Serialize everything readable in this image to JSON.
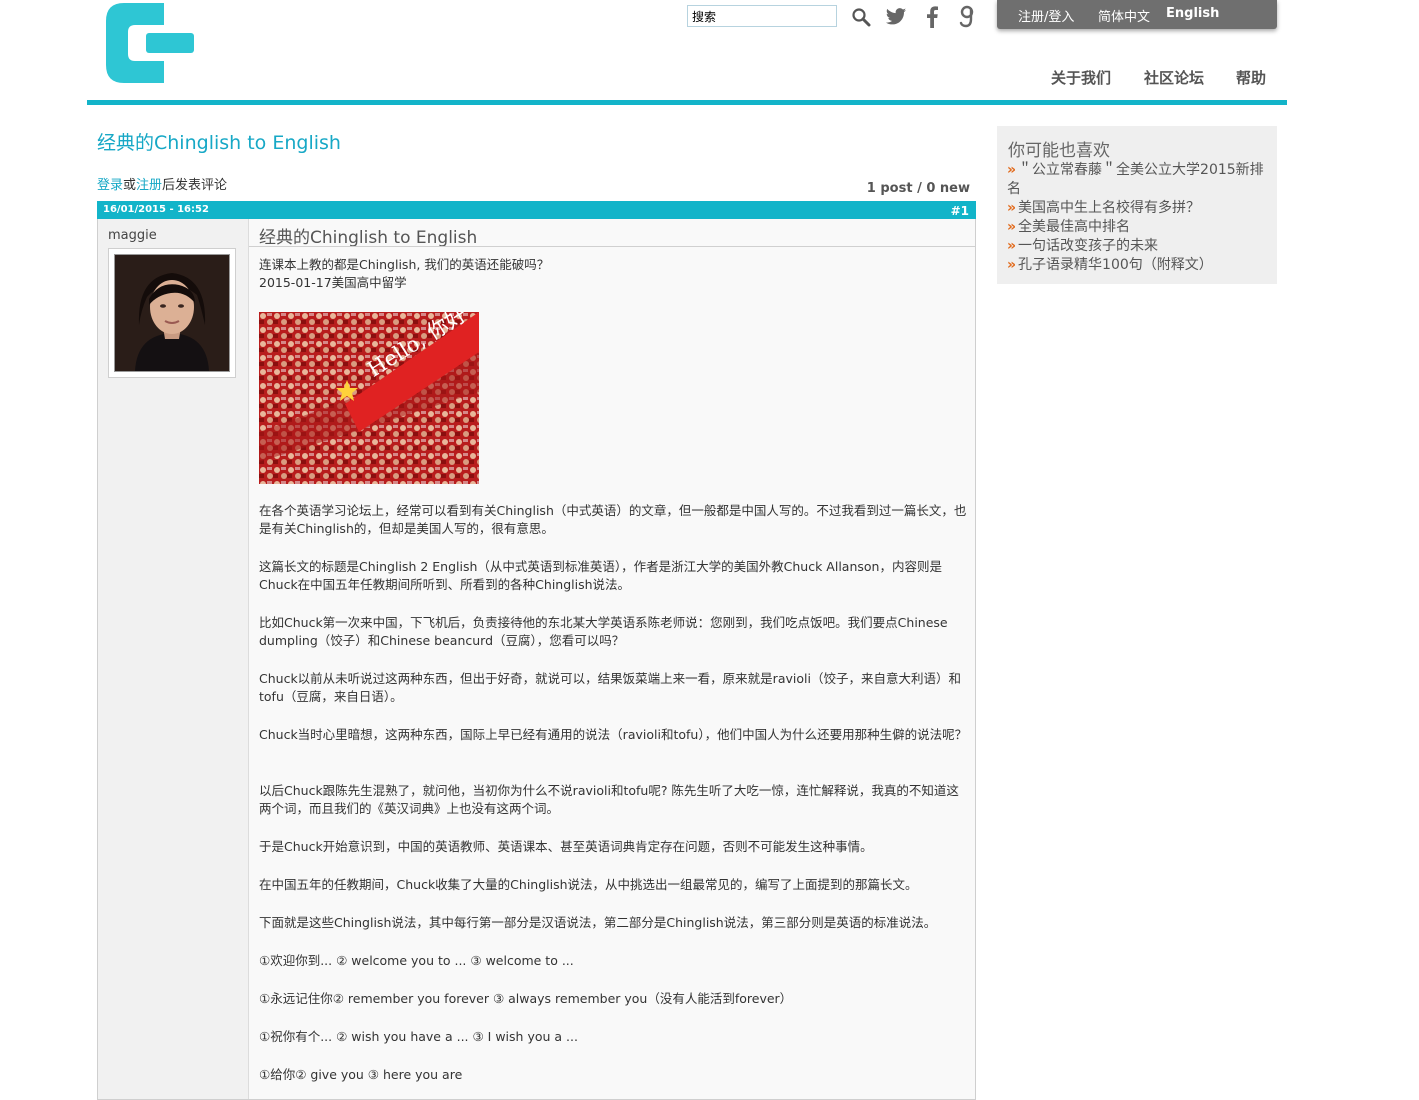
{
  "header": {
    "search_value": "搜索",
    "icons": [
      "search-icon",
      "twitter-icon",
      "facebook-icon",
      "google-icon"
    ],
    "topbar": {
      "register_login": "注册/登入",
      "simplified_chinese": "简体中文",
      "english": "English"
    },
    "nav": {
      "about": "关于我们",
      "forum": "社区论坛",
      "help": "帮助"
    }
  },
  "main": {
    "title": "经典的Chinglish to English",
    "login_link": "登录",
    "or_text": "或",
    "register_link": "注册",
    "after_text": "后发表评论",
    "post_count": "1 post / 0 new",
    "post": {
      "date": "16/01/2015 - 16:52",
      "number": "#1",
      "author": "maggie",
      "title": "经典的Chinglish to English",
      "image_text": "Hello, 你好",
      "paragraphs": [
        "连课本上教的都是Chinglish, 我们的英语还能破吗？",
        "2015-01-17美国高中留学",
        "在各个英语学习论坛上，经常可以看到有关Chinglish（中式英语）的文章，但一般都是中国人写的。不过我看到过一篇长文，也是有关Chinglish的，但却是美国人写的，很有意思。",
        "这篇长文的标题是Chinglish 2 English（从中式英语到标准英语），作者是浙江大学的美国外教Chuck Allanson，内容则是Chuck在中国五年任教期间所听到、所看到的各种Chinglish说法。",
        "比如Chuck第一次来中国，下飞机后，负责接待他的东北某大学英语系陈老师说：您刚到，我们吃点饭吧。我们要点Chinese dumpling（饺子）和Chinese beancurd（豆腐），您看可以吗？",
        "Chuck以前从未听说过这两种东西，但出于好奇，就说可以，结果饭菜端上来一看，原来就是ravioli（饺子，来自意大利语）和tofu（豆腐，来自日语）。",
        "Chuck当时心里暗想，这两种东西，国际上早已经有通用的说法（ravioli和tofu），他们中国人为什么还要用那种生僻的说法呢？",
        "以后Chuck跟陈先生混熟了，就问他，当初你为什么不说ravioli和tofu呢? 陈先生听了大吃一惊，连忙解释说，我真的不知道这两个词，而且我们的《英汉词典》上也没有这两个词。",
        "于是Chuck开始意识到，中国的英语教师、英语课本、甚至英语词典肯定存在问题，否则不可能发生这种事情。",
        "在中国五年的任教期间，Chuck收集了大量的Chinglish说法，从中挑选出一组最常见的，编写了上面提到的那篇长文。",
        "下面就是这些Chinglish说法，其中每行第一部分是汉语说法，第二部分是Chinglish说法，第三部分则是英语的标准说法。",
        "①欢迎你到... ② welcome you to ... ③ welcome to ...",
        "①永远记住你② remember you forever ③ always remember you（没有人能活到forever）",
        "①祝你有个... ② wish you have a ... ③ I wish you a ...",
        "①给你② give you ③ here you are"
      ]
    }
  },
  "sidebar": {
    "title": "你可能也喜欢",
    "arrow": "»",
    "items": [
      "＂公立常春藤＂全美公立大学2015新排名",
      "美国高中生上名校得有多拼？",
      "全美最佳高中排名",
      "一句话改变孩子的未来",
      "孔子语录精华100句（附释文）"
    ]
  },
  "colors": {
    "accent": "#13b4c9",
    "link": "#17a8c6",
    "topbar": "#6f6f6f",
    "sidebar_arrow": "#e26b1d"
  }
}
